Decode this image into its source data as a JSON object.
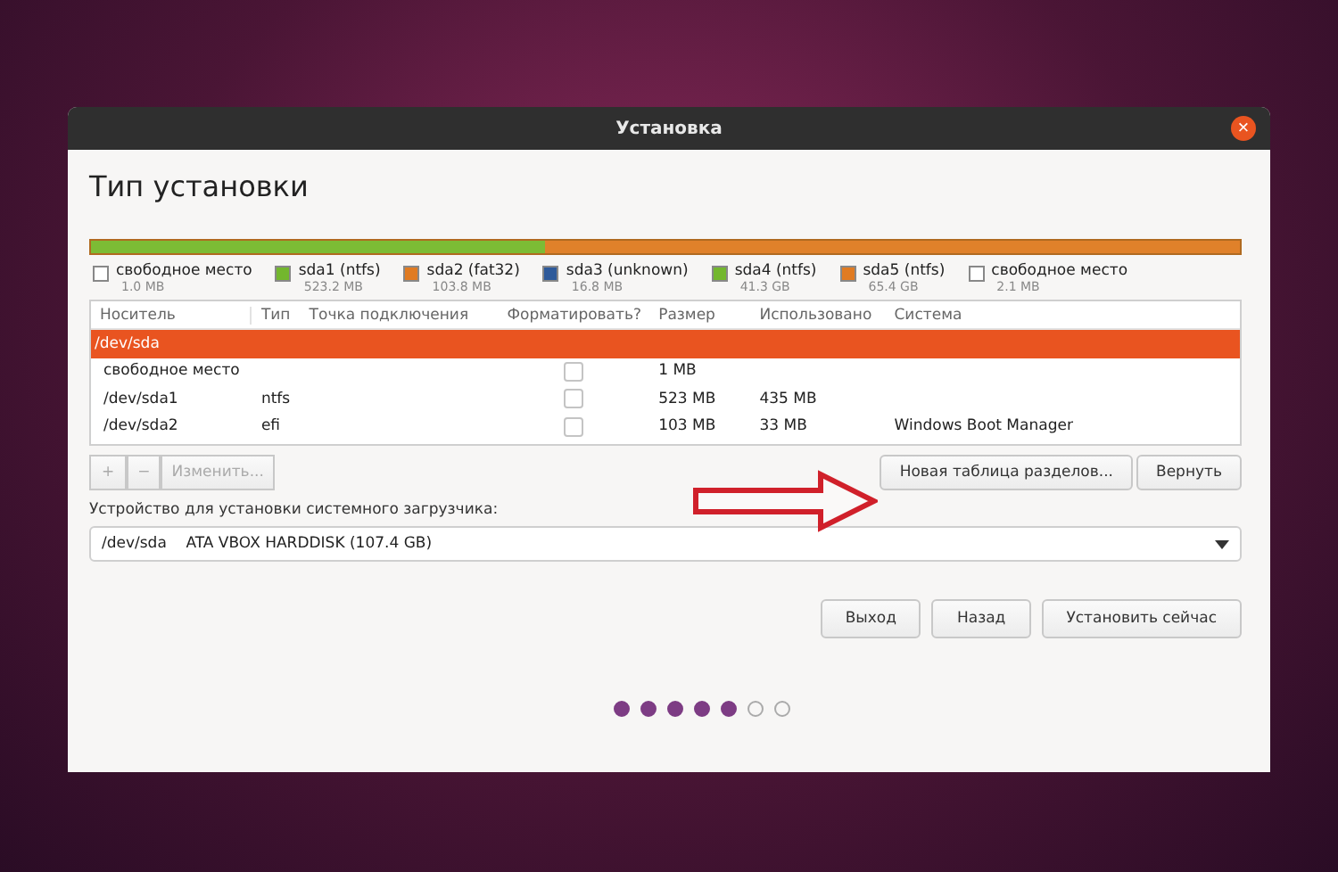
{
  "window": {
    "title": "Установка",
    "close": "×"
  },
  "heading": "Тип установки",
  "partitions": [
    {
      "name": "свободное место",
      "size": "1.0 MB",
      "color": "#ffffff"
    },
    {
      "name": "sda1 (ntfs)",
      "size": "523.2 MB",
      "color": "#73b72e"
    },
    {
      "name": "sda2 (fat32)",
      "size": "103.8 MB",
      "color": "#e07b22"
    },
    {
      "name": "sda3 (unknown)",
      "size": "16.8 MB",
      "color": "#2e5a9a"
    },
    {
      "name": "sda4 (ntfs)",
      "size": "41.3 GB",
      "color": "#73b72e"
    },
    {
      "name": "sda5 (ntfs)",
      "size": "65.4 GB",
      "color": "#e07b22"
    },
    {
      "name": "свободное место",
      "size": "2.1 MB",
      "color": "#ffffff"
    }
  ],
  "table": {
    "columns": [
      "Носитель",
      "Тип",
      "Точка подключения",
      "Форматировать?",
      "Размер",
      "Использовано",
      "Система"
    ],
    "rows": [
      {
        "kind": "device",
        "device": "/dev/sda",
        "selected": true
      },
      {
        "kind": "partition",
        "device": "свободное место",
        "type": "",
        "mount": "",
        "format": false,
        "size": "1 MB",
        "used": "",
        "system": "",
        "selected": false
      },
      {
        "kind": "partition",
        "device": "/dev/sda1",
        "type": "ntfs",
        "mount": "",
        "format": false,
        "size": "523 MB",
        "used": "435 MB",
        "system": "",
        "selected": false
      },
      {
        "kind": "partition",
        "device": "/dev/sda2",
        "type": "efi",
        "mount": "",
        "format": false,
        "size": "103 MB",
        "used": "33 MB",
        "system": "Windows Boot Manager",
        "selected": false
      }
    ]
  },
  "edit_buttons": [
    {
      "label": "+",
      "disabled": true
    },
    {
      "label": "−",
      "disabled": true
    },
    {
      "label": "Изменить...",
      "disabled": true
    }
  ],
  "table_buttons": [
    "Новая таблица разделов...",
    "Вернуть"
  ],
  "bootloader": {
    "label": "Устройство для установки системного загрузчика:",
    "value": "/dev/sda    ATA VBOX HARDDISK (107.4 GB)"
  },
  "buttons": [
    "Выход",
    "Назад",
    "Установить сейчас"
  ],
  "steps": [
    {
      "done": true
    },
    {
      "done": true
    },
    {
      "done": true
    },
    {
      "done": true
    },
    {
      "done": true
    },
    {
      "done": false
    },
    {
      "done": false
    }
  ]
}
